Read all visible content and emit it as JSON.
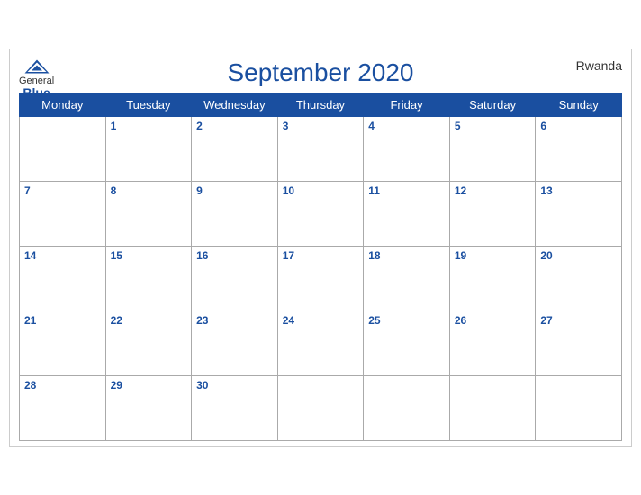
{
  "header": {
    "logo_general": "General",
    "logo_blue": "Blue",
    "title": "September 2020",
    "country": "Rwanda"
  },
  "weekdays": [
    "Monday",
    "Tuesday",
    "Wednesday",
    "Thursday",
    "Friday",
    "Saturday",
    "Sunday"
  ],
  "weeks": [
    [
      null,
      1,
      2,
      3,
      4,
      5,
      6
    ],
    [
      7,
      8,
      9,
      10,
      11,
      12,
      13
    ],
    [
      14,
      15,
      16,
      17,
      18,
      19,
      20
    ],
    [
      21,
      22,
      23,
      24,
      25,
      26,
      27
    ],
    [
      28,
      29,
      30,
      null,
      null,
      null,
      null
    ]
  ]
}
